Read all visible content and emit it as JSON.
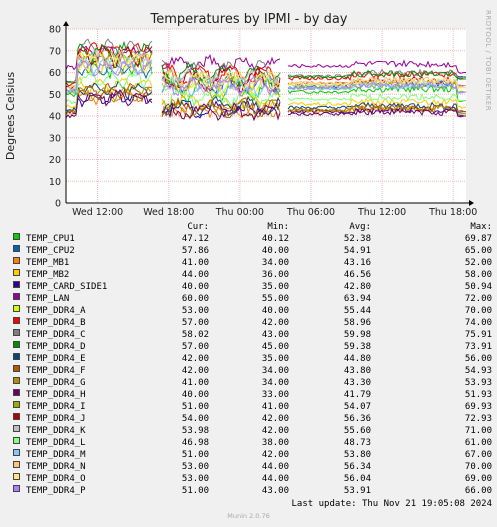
{
  "title": "Temperatures by IPMI - by day",
  "side_label": "RRDTOOL / TOBI OETIKER",
  "chart_data": {
    "type": "line",
    "title": "Temperatures by IPMI - by day",
    "ylabel": "Degrees Celsius",
    "ylim": [
      0,
      80
    ],
    "yticks": [
      "0",
      "10",
      "20",
      "30",
      "40",
      "50",
      "60",
      "70",
      "80"
    ],
    "grid": true,
    "xlim": [
      "Wed 09:20",
      "Thu 19:05"
    ],
    "xticks": [
      {
        "label": "Wed 12:00",
        "t": 2.67
      },
      {
        "label": "Wed 18:00",
        "t": 8.67
      },
      {
        "label": "Thu 00:00",
        "t": 14.67
      },
      {
        "label": "Thu 06:00",
        "t": 20.67
      },
      {
        "label": "Thu 12:00",
        "t": 26.67
      },
      {
        "label": "Thu 18:00",
        "t": 32.67
      }
    ],
    "gaps": [
      [
        7.3,
        8.1
      ],
      [
        18.1,
        18.6
      ]
    ],
    "columns": [
      "Cur:",
      "Min:",
      "Avg:",
      "Max:"
    ],
    "series": [
      {
        "name": "TEMP_CPU1",
        "color": "#00cc00",
        "cur": "47.12",
        "min": "40.12",
        "avg": "52.38",
        "max": "69.87"
      },
      {
        "name": "TEMP_CPU2",
        "color": "#0066b3",
        "cur": "57.86",
        "min": "40.00",
        "avg": "54.91",
        "max": "65.00"
      },
      {
        "name": "TEMP_MB1",
        "color": "#ff8000",
        "cur": "41.00",
        "min": "34.00",
        "avg": "43.16",
        "max": "52.00"
      },
      {
        "name": "TEMP_MB2",
        "color": "#ffcc00",
        "cur": "44.00",
        "min": "36.00",
        "avg": "46.56",
        "max": "58.00"
      },
      {
        "name": "TEMP_CARD_SIDE1",
        "color": "#330099",
        "cur": "40.00",
        "min": "35.00",
        "avg": "42.80",
        "max": "50.94"
      },
      {
        "name": "TEMP_LAN",
        "color": "#990099",
        "cur": "60.00",
        "min": "55.00",
        "avg": "63.94",
        "max": "72.00"
      },
      {
        "name": "TEMP_DDR4_A",
        "color": "#ccff00",
        "cur": "53.00",
        "min": "40.00",
        "avg": "55.44",
        "max": "70.00"
      },
      {
        "name": "TEMP_DDR4_B",
        "color": "#ff0000",
        "cur": "57.00",
        "min": "42.00",
        "avg": "58.96",
        "max": "74.00"
      },
      {
        "name": "TEMP_DDR4_C",
        "color": "#808080",
        "cur": "58.02",
        "min": "43.00",
        "avg": "59.98",
        "max": "75.91"
      },
      {
        "name": "TEMP_DDR4_D",
        "color": "#008f00",
        "cur": "57.00",
        "min": "45.00",
        "avg": "59.38",
        "max": "73.91"
      },
      {
        "name": "TEMP_DDR4_E",
        "color": "#00487d",
        "cur": "42.00",
        "min": "35.00",
        "avg": "44.80",
        "max": "56.00"
      },
      {
        "name": "TEMP_DDR4_F",
        "color": "#b35a00",
        "cur": "42.00",
        "min": "34.00",
        "avg": "43.80",
        "max": "54.93"
      },
      {
        "name": "TEMP_DDR4_G",
        "color": "#b38f00",
        "cur": "41.00",
        "min": "34.00",
        "avg": "43.30",
        "max": "53.93"
      },
      {
        "name": "TEMP_DDR4_H",
        "color": "#6b006b",
        "cur": "40.00",
        "min": "33.00",
        "avg": "41.79",
        "max": "51.93"
      },
      {
        "name": "TEMP_DDR4_I",
        "color": "#8fb300",
        "cur": "51.00",
        "min": "41.00",
        "avg": "54.07",
        "max": "69.93"
      },
      {
        "name": "TEMP_DDR4_J",
        "color": "#b30000",
        "cur": "54.00",
        "min": "42.00",
        "avg": "56.36",
        "max": "72.93"
      },
      {
        "name": "TEMP_DDR4_K",
        "color": "#bebebe",
        "cur": "53.98",
        "min": "42.00",
        "avg": "55.60",
        "max": "71.00"
      },
      {
        "name": "TEMP_DDR4_L",
        "color": "#80ff80",
        "cur": "46.98",
        "min": "38.00",
        "avg": "48.73",
        "max": "61.00"
      },
      {
        "name": "TEMP_DDR4_M",
        "color": "#80c9ff",
        "cur": "51.00",
        "min": "42.00",
        "avg": "53.80",
        "max": "67.00"
      },
      {
        "name": "TEMP_DDR4_N",
        "color": "#ffc080",
        "cur": "53.00",
        "min": "44.00",
        "avg": "56.34",
        "max": "70.00"
      },
      {
        "name": "TEMP_DDR4_O",
        "color": "#ffe680",
        "cur": "53.00",
        "min": "44.00",
        "avg": "56.04",
        "max": "69.00"
      },
      {
        "name": "TEMP_DDR4_P",
        "color": "#aa80ff",
        "cur": "51.00",
        "min": "43.00",
        "avg": "53.91",
        "max": "66.00"
      }
    ]
  },
  "last_update": "Last update: Thu Nov 21 19:05:08 2024",
  "munin_version": "Munin 2.0.76"
}
